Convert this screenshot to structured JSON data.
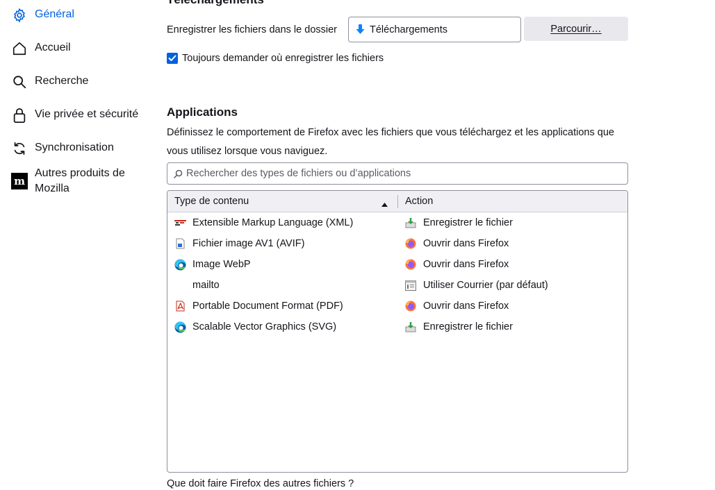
{
  "sidebar": {
    "items": [
      {
        "label": "Général",
        "icon": "gear-icon",
        "active": true
      },
      {
        "label": "Accueil",
        "icon": "home-icon"
      },
      {
        "label": "Recherche",
        "icon": "search-icon"
      },
      {
        "label": "Vie privée et sécurité",
        "icon": "lock-icon"
      },
      {
        "label": "Synchronisation",
        "icon": "sync-icon"
      },
      {
        "label": "Autres produits de Mozilla",
        "icon": "mozilla-logo-icon"
      }
    ]
  },
  "downloads": {
    "heading": "Téléchargements",
    "save_label": "Enregistrer les fichiers dans le dossier",
    "folder_value": "Téléchargements",
    "browse_label": "Parcourir…",
    "always_ask_label": "Toujours demander où enregistrer les fichiers",
    "always_ask_checked": true
  },
  "applications": {
    "heading": "Applications",
    "description": "Définissez le comportement de Firefox avec les fichiers que vous téléchargez et les applications que vous utilisez lorsque vous naviguez.",
    "search_placeholder": "Rechercher des types de fichiers ou d’applications",
    "columns": {
      "type": "Type de contenu",
      "action": "Action"
    },
    "rows": [
      {
        "type": "Extensible Markup Language (XML)",
        "type_icon": "xml-file-icon",
        "action": "Enregistrer le fichier",
        "action_icon": "save-file-icon"
      },
      {
        "type": "Fichier image AV1 (AVIF)",
        "type_icon": "image-file-icon",
        "action": "Ouvrir dans Firefox",
        "action_icon": "firefox-icon"
      },
      {
        "type": "Image WebP",
        "type_icon": "edge-icon",
        "action": "Ouvrir dans Firefox",
        "action_icon": "firefox-icon"
      },
      {
        "type": "mailto",
        "type_icon": "",
        "action": "Utiliser Courrier (par défaut)",
        "action_icon": "mail-app-icon"
      },
      {
        "type": "Portable Document Format (PDF)",
        "type_icon": "pdf-file-icon",
        "action": "Ouvrir dans Firefox",
        "action_icon": "firefox-icon"
      },
      {
        "type": "Scalable Vector Graphics (SVG)",
        "type_icon": "edge-icon",
        "action": "Enregistrer le fichier",
        "action_icon": "save-file-icon"
      }
    ],
    "other_files_label": "Que doit faire Firefox des autres fichiers ?"
  },
  "colors": {
    "accent": "#0061e0",
    "text": "#15141a",
    "button_bg": "#e9e9ed",
    "header_bg": "#f0f0f4"
  }
}
